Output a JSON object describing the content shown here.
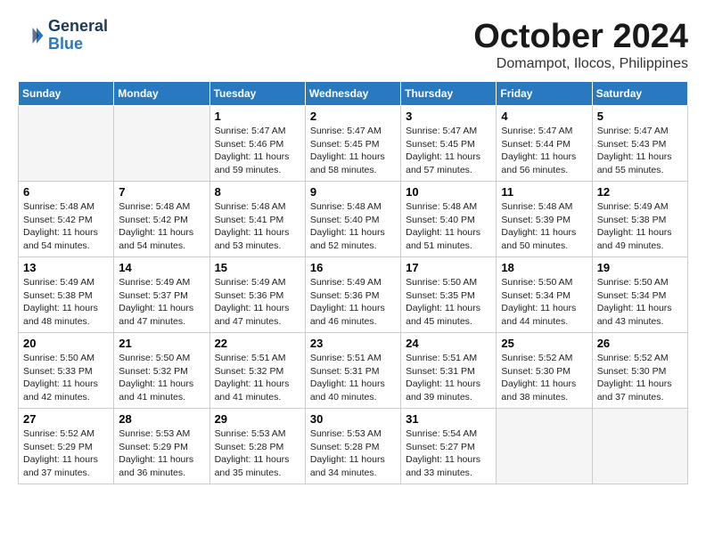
{
  "logo": {
    "line1": "General",
    "line2": "Blue"
  },
  "title": "October 2024",
  "location": "Domampot, Ilocos, Philippines",
  "weekdays": [
    "Sunday",
    "Monday",
    "Tuesday",
    "Wednesday",
    "Thursday",
    "Friday",
    "Saturday"
  ],
  "weeks": [
    [
      {
        "day": "",
        "info": ""
      },
      {
        "day": "",
        "info": ""
      },
      {
        "day": "1",
        "info": "Sunrise: 5:47 AM\nSunset: 5:46 PM\nDaylight: 11 hours\nand 59 minutes."
      },
      {
        "day": "2",
        "info": "Sunrise: 5:47 AM\nSunset: 5:45 PM\nDaylight: 11 hours\nand 58 minutes."
      },
      {
        "day": "3",
        "info": "Sunrise: 5:47 AM\nSunset: 5:45 PM\nDaylight: 11 hours\nand 57 minutes."
      },
      {
        "day": "4",
        "info": "Sunrise: 5:47 AM\nSunset: 5:44 PM\nDaylight: 11 hours\nand 56 minutes."
      },
      {
        "day": "5",
        "info": "Sunrise: 5:47 AM\nSunset: 5:43 PM\nDaylight: 11 hours\nand 55 minutes."
      }
    ],
    [
      {
        "day": "6",
        "info": "Sunrise: 5:48 AM\nSunset: 5:42 PM\nDaylight: 11 hours\nand 54 minutes."
      },
      {
        "day": "7",
        "info": "Sunrise: 5:48 AM\nSunset: 5:42 PM\nDaylight: 11 hours\nand 54 minutes."
      },
      {
        "day": "8",
        "info": "Sunrise: 5:48 AM\nSunset: 5:41 PM\nDaylight: 11 hours\nand 53 minutes."
      },
      {
        "day": "9",
        "info": "Sunrise: 5:48 AM\nSunset: 5:40 PM\nDaylight: 11 hours\nand 52 minutes."
      },
      {
        "day": "10",
        "info": "Sunrise: 5:48 AM\nSunset: 5:40 PM\nDaylight: 11 hours\nand 51 minutes."
      },
      {
        "day": "11",
        "info": "Sunrise: 5:48 AM\nSunset: 5:39 PM\nDaylight: 11 hours\nand 50 minutes."
      },
      {
        "day": "12",
        "info": "Sunrise: 5:49 AM\nSunset: 5:38 PM\nDaylight: 11 hours\nand 49 minutes."
      }
    ],
    [
      {
        "day": "13",
        "info": "Sunrise: 5:49 AM\nSunset: 5:38 PM\nDaylight: 11 hours\nand 48 minutes."
      },
      {
        "day": "14",
        "info": "Sunrise: 5:49 AM\nSunset: 5:37 PM\nDaylight: 11 hours\nand 47 minutes."
      },
      {
        "day": "15",
        "info": "Sunrise: 5:49 AM\nSunset: 5:36 PM\nDaylight: 11 hours\nand 47 minutes."
      },
      {
        "day": "16",
        "info": "Sunrise: 5:49 AM\nSunset: 5:36 PM\nDaylight: 11 hours\nand 46 minutes."
      },
      {
        "day": "17",
        "info": "Sunrise: 5:50 AM\nSunset: 5:35 PM\nDaylight: 11 hours\nand 45 minutes."
      },
      {
        "day": "18",
        "info": "Sunrise: 5:50 AM\nSunset: 5:34 PM\nDaylight: 11 hours\nand 44 minutes."
      },
      {
        "day": "19",
        "info": "Sunrise: 5:50 AM\nSunset: 5:34 PM\nDaylight: 11 hours\nand 43 minutes."
      }
    ],
    [
      {
        "day": "20",
        "info": "Sunrise: 5:50 AM\nSunset: 5:33 PM\nDaylight: 11 hours\nand 42 minutes."
      },
      {
        "day": "21",
        "info": "Sunrise: 5:50 AM\nSunset: 5:32 PM\nDaylight: 11 hours\nand 41 minutes."
      },
      {
        "day": "22",
        "info": "Sunrise: 5:51 AM\nSunset: 5:32 PM\nDaylight: 11 hours\nand 41 minutes."
      },
      {
        "day": "23",
        "info": "Sunrise: 5:51 AM\nSunset: 5:31 PM\nDaylight: 11 hours\nand 40 minutes."
      },
      {
        "day": "24",
        "info": "Sunrise: 5:51 AM\nSunset: 5:31 PM\nDaylight: 11 hours\nand 39 minutes."
      },
      {
        "day": "25",
        "info": "Sunrise: 5:52 AM\nSunset: 5:30 PM\nDaylight: 11 hours\nand 38 minutes."
      },
      {
        "day": "26",
        "info": "Sunrise: 5:52 AM\nSunset: 5:30 PM\nDaylight: 11 hours\nand 37 minutes."
      }
    ],
    [
      {
        "day": "27",
        "info": "Sunrise: 5:52 AM\nSunset: 5:29 PM\nDaylight: 11 hours\nand 37 minutes."
      },
      {
        "day": "28",
        "info": "Sunrise: 5:53 AM\nSunset: 5:29 PM\nDaylight: 11 hours\nand 36 minutes."
      },
      {
        "day": "29",
        "info": "Sunrise: 5:53 AM\nSunset: 5:28 PM\nDaylight: 11 hours\nand 35 minutes."
      },
      {
        "day": "30",
        "info": "Sunrise: 5:53 AM\nSunset: 5:28 PM\nDaylight: 11 hours\nand 34 minutes."
      },
      {
        "day": "31",
        "info": "Sunrise: 5:54 AM\nSunset: 5:27 PM\nDaylight: 11 hours\nand 33 minutes."
      },
      {
        "day": "",
        "info": ""
      },
      {
        "day": "",
        "info": ""
      }
    ]
  ]
}
